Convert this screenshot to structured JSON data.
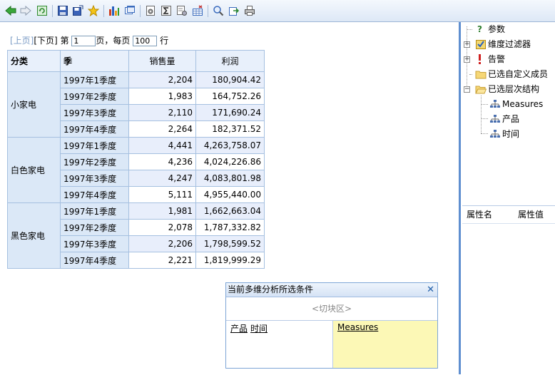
{
  "toolbar": {
    "buttons": [
      {
        "icon": "back-arrow-icon",
        "color": "#2e9a2e"
      },
      {
        "icon": "forward-arrow-icon",
        "color": "#9aa8b8"
      },
      {
        "icon": "refresh-icon",
        "color": "#2e9a2e"
      },
      {
        "icon": "save-icon",
        "color": "#2a4fa8"
      },
      {
        "icon": "save-as-icon",
        "color": "#2a4fa8"
      },
      {
        "icon": "favorite-star-icon",
        "color": "#f0c020"
      },
      {
        "icon": "chart-icon",
        "color": "#d04020"
      },
      {
        "icon": "window-icon",
        "color": "#3a6bbd"
      },
      {
        "icon": "settings-doc-icon",
        "color": "#666"
      },
      {
        "icon": "sigma-sum-icon",
        "color": "#333"
      },
      {
        "icon": "calc-settings-icon",
        "color": "#666"
      },
      {
        "icon": "delete-grid-icon",
        "color": "#c03030"
      },
      {
        "icon": "search-icon",
        "color": "#3a6bbd"
      },
      {
        "icon": "export-icon",
        "color": "#3a6bbd"
      },
      {
        "icon": "print-icon",
        "color": "#666"
      }
    ]
  },
  "pager": {
    "prev": "[上页]",
    "next": "[下页]",
    "page_prefix": "第",
    "current_page": "1",
    "page_suffix": "页，每页",
    "page_size": "100",
    "rows_suffix": "行"
  },
  "table": {
    "headers": {
      "category": "分类",
      "quarter": "季",
      "sales": "销售量",
      "profit": "利润"
    },
    "groups": [
      {
        "category": "小家电",
        "rows": [
          {
            "quarter": "1997年1季度",
            "sales": "2,204",
            "profit": "180,904.42"
          },
          {
            "quarter": "1997年2季度",
            "sales": "1,983",
            "profit": "164,752.26"
          },
          {
            "quarter": "1997年3季度",
            "sales": "2,110",
            "profit": "171,690.24"
          },
          {
            "quarter": "1997年4季度",
            "sales": "2,264",
            "profit": "182,371.52"
          }
        ]
      },
      {
        "category": "白色家电",
        "rows": [
          {
            "quarter": "1997年1季度",
            "sales": "4,441",
            "profit": "4,263,758.07"
          },
          {
            "quarter": "1997年2季度",
            "sales": "4,236",
            "profit": "4,024,226.86"
          },
          {
            "quarter": "1997年3季度",
            "sales": "4,247",
            "profit": "4,083,801.98"
          },
          {
            "quarter": "1997年4季度",
            "sales": "5,111",
            "profit": "4,955,440.00"
          }
        ]
      },
      {
        "category": "黑色家电",
        "rows": [
          {
            "quarter": "1997年1季度",
            "sales": "1,981",
            "profit": "1,662,663.04"
          },
          {
            "quarter": "1997年2季度",
            "sales": "2,078",
            "profit": "1,787,332.82"
          },
          {
            "quarter": "1997年3季度",
            "sales": "2,206",
            "profit": "1,798,599.52"
          },
          {
            "quarter": "1997年4季度",
            "sales": "2,221",
            "profit": "1,819,999.29"
          }
        ]
      }
    ]
  },
  "conditions": {
    "title": "当前多维分析所选条件",
    "slice_placeholder": "<切块区>",
    "rows": [
      "产品",
      "时间"
    ],
    "columns": [
      "Measures"
    ]
  },
  "tree": {
    "items": [
      {
        "label": "参数",
        "icon": "question-icon"
      },
      {
        "label": "维度过滤器",
        "icon": "filter-icon"
      },
      {
        "label": "告警",
        "icon": "alert-icon"
      },
      {
        "label": "已选自定义成员",
        "icon": "folder-icon"
      },
      {
        "label": "已选层次结构",
        "icon": "folder-open-icon"
      },
      {
        "label": "Measures",
        "icon": "hierarchy-icon"
      },
      {
        "label": "产品",
        "icon": "hierarchy-icon"
      },
      {
        "label": "时间",
        "icon": "hierarchy-icon"
      }
    ]
  },
  "properties": {
    "name_header": "属性名",
    "value_header": "属性值"
  }
}
